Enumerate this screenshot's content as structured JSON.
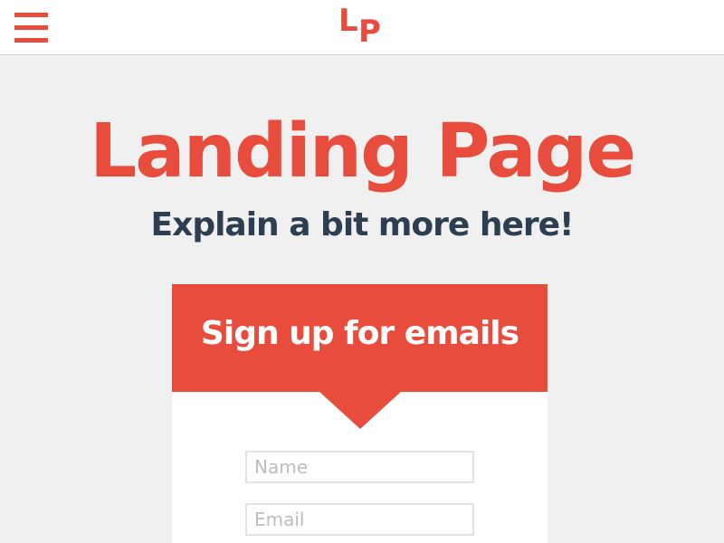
{
  "header": {
    "logo_l": "L",
    "logo_p": "P",
    "menu_icon": "hamburger-menu-icon"
  },
  "hero": {
    "title": "Landing Page",
    "subtitle": "Explain a bit more here!"
  },
  "signup": {
    "heading": "Sign up for emails",
    "name_placeholder": "Name",
    "email_placeholder": "Email",
    "name_value": "",
    "email_value": ""
  },
  "colors": {
    "accent": "#e74c3c",
    "dark": "#2c3e50",
    "background": "#f0f0f0"
  }
}
